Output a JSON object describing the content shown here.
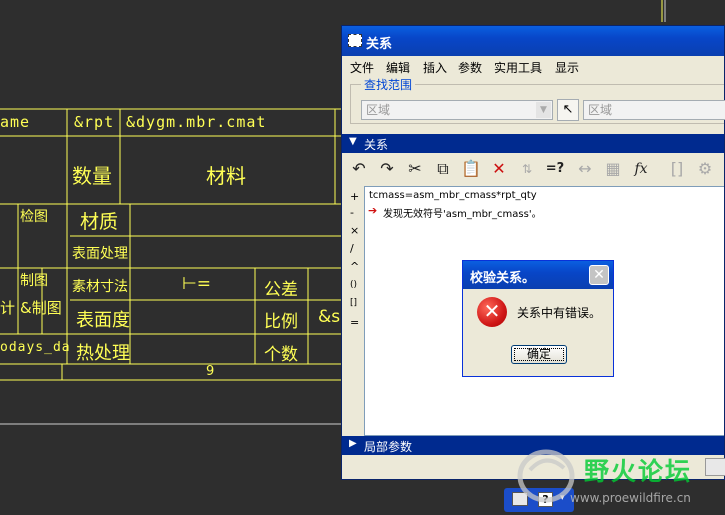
{
  "drawing": {
    "header_row": [
      "ame",
      "&rpt",
      "&dygm.mbr.cmat"
    ],
    "qty_label": "数量",
    "material_label": "材料",
    "check_label": "检图",
    "material_quality": "材质",
    "surface_treatment": "表面处理",
    "draw_label": "制图",
    "draw_ref": "&制图",
    "stock_size": "素材寸法",
    "stock_value": "⊢=",
    "tolerance": "公差",
    "surface_finish": "表面度",
    "scale": "比例",
    "scale_ref": "&s",
    "heat_treatment": "热处理",
    "count": "个数",
    "date_ref": "odays_da",
    "sheet_no": "9",
    "design_left": "计"
  },
  "window": {
    "title": "关系",
    "menu": [
      "文件",
      "编辑",
      "插入",
      "参数",
      "实用工具",
      "显示"
    ],
    "search_scope_label": "查找范围",
    "combo1_value": "区域",
    "combo2_value": "区域",
    "relations_section": "关系",
    "local_params_section": "局部参数",
    "side_buttons": [
      "+",
      "-",
      "×",
      "/",
      "^",
      "()",
      "[]",
      "="
    ],
    "editor_lines": [
      "tcmass=asm_mbr_cmass*rpt_qty",
      "发现无效符号'asm_mbr_cmass'。"
    ]
  },
  "dialog": {
    "title": "校验关系。",
    "message": "关系中有错误。",
    "ok_label": "确定"
  },
  "watermark": {
    "title": "野火论坛",
    "url": "www.proewildfire.cn"
  },
  "colors": {
    "cad_background": "#2e2e2e",
    "cad_lines": "#ffff55",
    "xp_title": "#0846c8",
    "section_bar": "#002a8f"
  }
}
